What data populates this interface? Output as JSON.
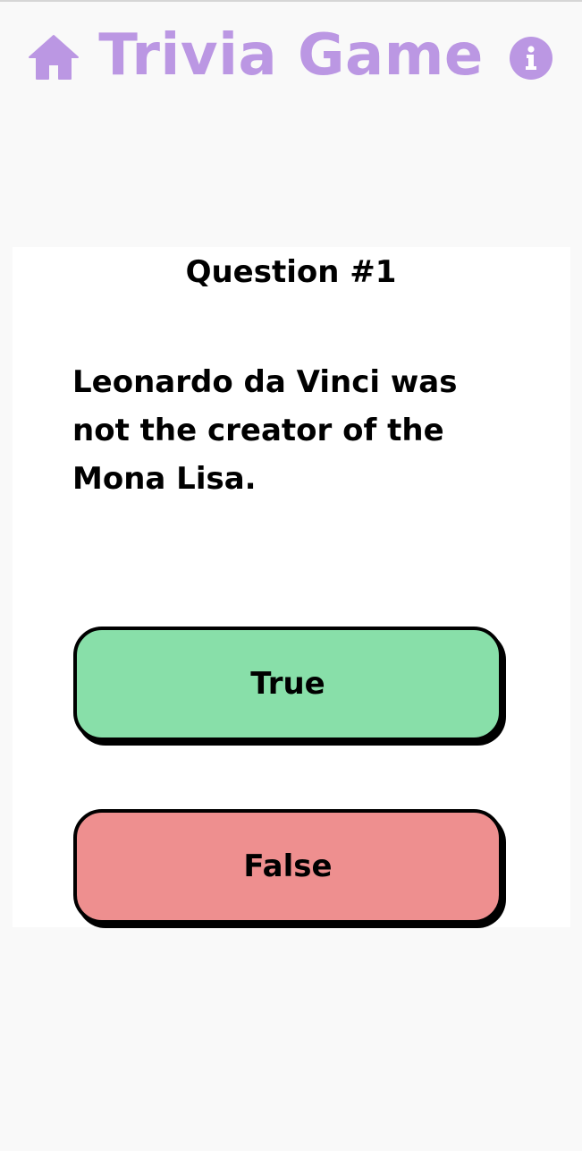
{
  "header": {
    "title": "Trivia Game",
    "home_icon": "home-icon",
    "info_icon": "info-icon"
  },
  "quiz": {
    "question_number": "Question #1",
    "question_text": "Leonardo da Vinci was not the creator of the Mona Lisa.",
    "answers": [
      {
        "label": "True",
        "color": "#88dfa9"
      },
      {
        "label": "False",
        "color": "#ee8f8f"
      }
    ]
  },
  "colors": {
    "accent": "#bb97e3",
    "background": "#f9f9f9",
    "card": "#ffffff",
    "true_button": "#88dfa9",
    "false_button": "#ee8f8f"
  }
}
